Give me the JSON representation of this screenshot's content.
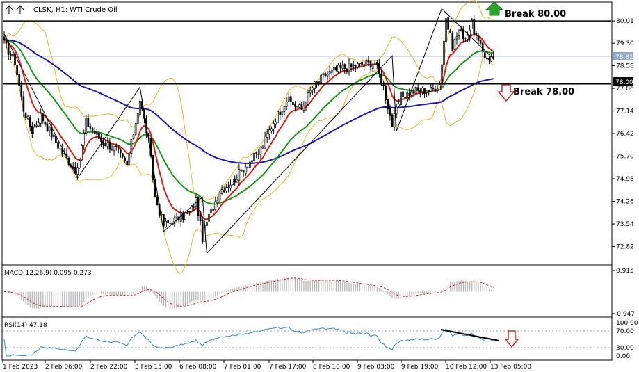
{
  "chart_header": {
    "symbol": "CLSK, H1:",
    "description": "WTI Crude Oil"
  },
  "colors": {
    "background": "#ffffff",
    "frame": "#000000",
    "bull": "#000000",
    "bear": "#000000",
    "ma_fast": "#e0190f",
    "ma_mid": "#119a11",
    "ma_slow": "#1616c8",
    "bollinger": "#e8b320",
    "zigzag": "#000000",
    "current_line": "#8fa8c8",
    "up_arrow": "#1f9a1f",
    "down_arrow": "#d81f1f",
    "macd_hist": "#b8b8b8",
    "macd_signal": "#e0190f",
    "rsi_line": "#2a8bd6",
    "rsi_levels": "#a0a0a0"
  },
  "price_axis": {
    "labels": [
      "80.01",
      "79.30",
      "78.58",
      "77.86",
      "77.14",
      "76.42",
      "75.70",
      "74.98",
      "74.26",
      "73.54",
      "72.82"
    ],
    "current_price": "78.81",
    "level_label": "78.00"
  },
  "annotations": {
    "upper_text": "Break 80.00",
    "lower_text": "Break 78.00",
    "upper_level": 80.01,
    "lower_level": 78.0
  },
  "macd": {
    "label": "MACD(12,26,9) 0.095 0.273",
    "axis_labels": [
      "0.915",
      "-0.947"
    ]
  },
  "rsi": {
    "label": "RSI(14) 47.18",
    "axis_labels": [
      "100.00",
      "70.00",
      "30.00",
      "0.00"
    ]
  },
  "time_axis": {
    "labels": [
      "1 Feb 2023",
      "2 Feb 06:00",
      "2 Feb 22:00",
      "3 Feb 15:00",
      "6 Feb 08:00",
      "7 Feb 01:00",
      "7 Feb 17:00",
      "8 Feb 10:00",
      "9 Feb 03:00",
      "9 Feb 19:00",
      "10 Feb 12:00",
      "13 Feb 05:00"
    ]
  },
  "chart_data": {
    "type": "candlestick",
    "title": "CLSK, H1: WTI Crude Oil",
    "ylim": [
      72.3,
      80.5
    ],
    "price_key_points": [
      {
        "bar": 0,
        "price": 79.3
      },
      {
        "bar": 5,
        "price": 78.7
      },
      {
        "bar": 9,
        "price": 77.2
      },
      {
        "bar": 13,
        "price": 76.5
      },
      {
        "bar": 17,
        "price": 77.0
      },
      {
        "bar": 27,
        "price": 75.8
      },
      {
        "bar": 34,
        "price": 75.2
      },
      {
        "bar": 38,
        "price": 76.8
      },
      {
        "bar": 45,
        "price": 76.2
      },
      {
        "bar": 52,
        "price": 75.9
      },
      {
        "bar": 57,
        "price": 75.4
      },
      {
        "bar": 63,
        "price": 77.5
      },
      {
        "bar": 67,
        "price": 76.2
      },
      {
        "bar": 70,
        "price": 74.4
      },
      {
        "bar": 74,
        "price": 73.5
      },
      {
        "bar": 80,
        "price": 73.7
      },
      {
        "bar": 86,
        "price": 73.9
      },
      {
        "bar": 89,
        "price": 74.3
      },
      {
        "bar": 92,
        "price": 73.1
      },
      {
        "bar": 94,
        "price": 73.6
      },
      {
        "bar": 100,
        "price": 74.6
      },
      {
        "bar": 106,
        "price": 74.9
      },
      {
        "bar": 112,
        "price": 75.4
      },
      {
        "bar": 118,
        "price": 75.8
      },
      {
        "bar": 125,
        "price": 76.8
      },
      {
        "bar": 131,
        "price": 77.5
      },
      {
        "bar": 138,
        "price": 77.2
      },
      {
        "bar": 143,
        "price": 77.9
      },
      {
        "bar": 149,
        "price": 78.3
      },
      {
        "bar": 156,
        "price": 78.5
      },
      {
        "bar": 165,
        "price": 78.6
      },
      {
        "bar": 172,
        "price": 78.7
      },
      {
        "bar": 176,
        "price": 77.9
      },
      {
        "bar": 180,
        "price": 76.7
      },
      {
        "bar": 184,
        "price": 77.6
      },
      {
        "bar": 191,
        "price": 77.8
      },
      {
        "bar": 198,
        "price": 77.8
      },
      {
        "bar": 202,
        "price": 78.0
      },
      {
        "bar": 205,
        "price": 80.1
      },
      {
        "bar": 208,
        "price": 79.2
      },
      {
        "bar": 211,
        "price": 79.7
      },
      {
        "bar": 214,
        "price": 79.5
      },
      {
        "bar": 217,
        "price": 79.9
      },
      {
        "bar": 220,
        "price": 79.3
      },
      {
        "bar": 223,
        "price": 78.9
      },
      {
        "bar": 227,
        "price": 78.8
      }
    ],
    "zigzag": [
      {
        "bar": 0,
        "price": 79.6
      },
      {
        "bar": 34,
        "price": 75.0
      },
      {
        "bar": 63,
        "price": 77.9
      },
      {
        "bar": 74,
        "price": 73.3
      },
      {
        "bar": 92,
        "price": 74.4
      },
      {
        "bar": 94,
        "price": 72.6
      },
      {
        "bar": 180,
        "price": 78.9
      },
      {
        "bar": 182,
        "price": 76.5
      },
      {
        "bar": 203,
        "price": 80.4
      },
      {
        "bar": 227,
        "price": 78.8
      }
    ],
    "bollinger_period": 20,
    "ma_periods": [
      10,
      30,
      100
    ],
    "macd": {
      "ylim": [
        -0.947,
        0.915
      ],
      "params": "12,26,9"
    },
    "rsi": {
      "ylim": [
        0,
        100
      ],
      "levels": [
        70,
        30
      ],
      "period": 14
    },
    "xlabel": "",
    "ylabel": ""
  }
}
